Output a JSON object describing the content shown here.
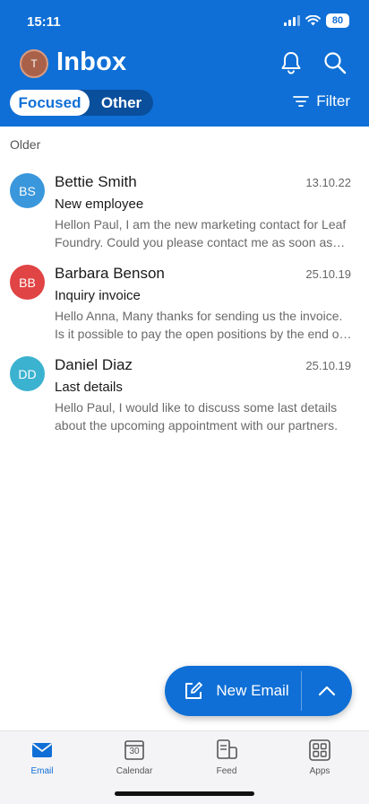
{
  "status_bar": {
    "time": "15:11",
    "battery": "80",
    "icons": [
      "signal-icon",
      "wifi-icon",
      "battery-icon"
    ]
  },
  "header": {
    "avatar_initial": "T",
    "title": "Inbox",
    "icons": [
      "bell-icon",
      "search-icon"
    ],
    "tabs": [
      {
        "label": "Focused",
        "selected": true
      },
      {
        "label": "Other",
        "selected": false
      }
    ],
    "filter_label": "Filter"
  },
  "list": {
    "section_label": "Older",
    "messages": [
      {
        "initials": "BS",
        "sender": "Bettie Smith",
        "date": "13.10.22",
        "subject": "New employee",
        "preview": "Hellon Paul, I am the new marketing contact for Leaf Foundry. Could you please contact me as soon as possible?",
        "avatar_color": "#3a97dc"
      },
      {
        "initials": "BB",
        "sender": "Barbara Benson",
        "date": "25.10.19",
        "subject": "Inquiry invoice",
        "preview": "Hello Anna, Many thanks for sending us the invoice. Is it possible to pay the open positions by the end of the month?",
        "avatar_color": "#e04444"
      },
      {
        "initials": "DD",
        "sender": "Daniel Diaz",
        "date": "25.10.19",
        "subject": "Last details",
        "preview": "Hello Paul, I would like to discuss some last details about the upcoming appointment with our partners.",
        "avatar_color": "#3bb2cf"
      }
    ]
  },
  "fab": {
    "label": "New Email",
    "icons": [
      "compose-icon",
      "chevron-up-icon"
    ]
  },
  "bottom_nav": {
    "items": [
      {
        "label": "Email",
        "icon": "mail-icon",
        "active": true
      },
      {
        "label": "Calendar",
        "icon": "calendar-icon",
        "active": false,
        "badge": "30"
      },
      {
        "label": "Feed",
        "icon": "feed-icon",
        "active": false
      },
      {
        "label": "Apps",
        "icon": "apps-icon",
        "active": false
      }
    ]
  },
  "colors": {
    "brand": "#0f6fd6",
    "tab_track": "#0a4f9c"
  }
}
